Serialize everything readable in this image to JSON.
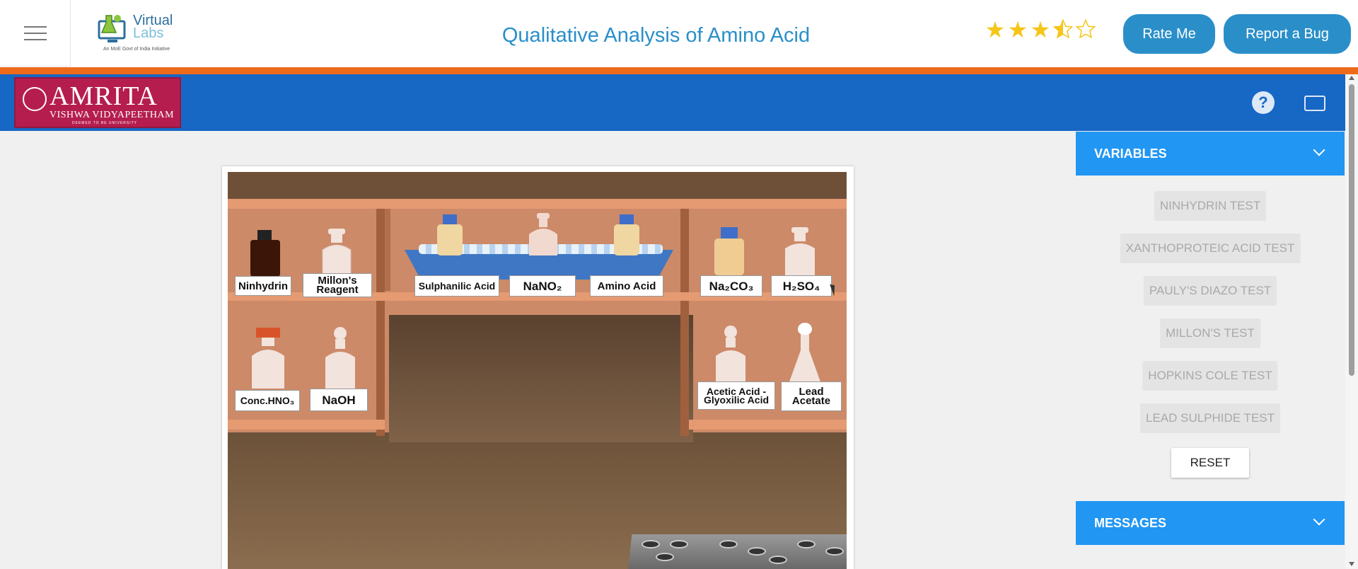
{
  "header": {
    "title": "Qualitative Analysis of Amino Acid",
    "logo": {
      "brand_a": "Virtual",
      "brand_b": "Labs",
      "tagline": "An MoE Govt of India Initiative"
    },
    "rating": {
      "value": 3.5,
      "max": 5
    },
    "rate_label": "Rate Me",
    "bug_label": "Report a Bug",
    "accent_color": "#2a8fc9",
    "stripe_color": "#ee6a1b"
  },
  "banner": {
    "institution": "AMRITA",
    "institution_sub": "VISHWA VIDYAPEETHAM",
    "institution_sub2": "DEEMED TO BE UNIVERSITY",
    "help_icon": "question-circle-icon",
    "fullscreen_icon": "fullscreen-icon",
    "bar_color": "#1767c4"
  },
  "simulation": {
    "reagents_top_left": [
      "Ninhydrin",
      "Millon's Reagent"
    ],
    "reagents_top_middle": [
      "Sulphanilic Acid",
      "NaNO₂",
      "Amino Acid"
    ],
    "reagents_top_right": [
      "Na₂CO₃",
      "H₂SO₄"
    ],
    "reagents_bottom_left": [
      "Conc.HNO₃",
      "NaOH"
    ],
    "reagents_bottom_right": [
      "Acetic Acid - Glyoxilic Acid",
      "Lead Acetate"
    ]
  },
  "panel": {
    "variables_title": "VARIABLES",
    "messages_title": "MESSAGES",
    "tests": [
      "NINHYDRIN TEST",
      "XANTHOPROTEIC ACID TEST",
      "PAULY'S DIAZO TEST",
      "MILLON'S TEST",
      "HOPKINS COLE TEST",
      "LEAD SULPHIDE TEST"
    ],
    "reset_label": "RESET",
    "header_color": "#2196f3"
  }
}
